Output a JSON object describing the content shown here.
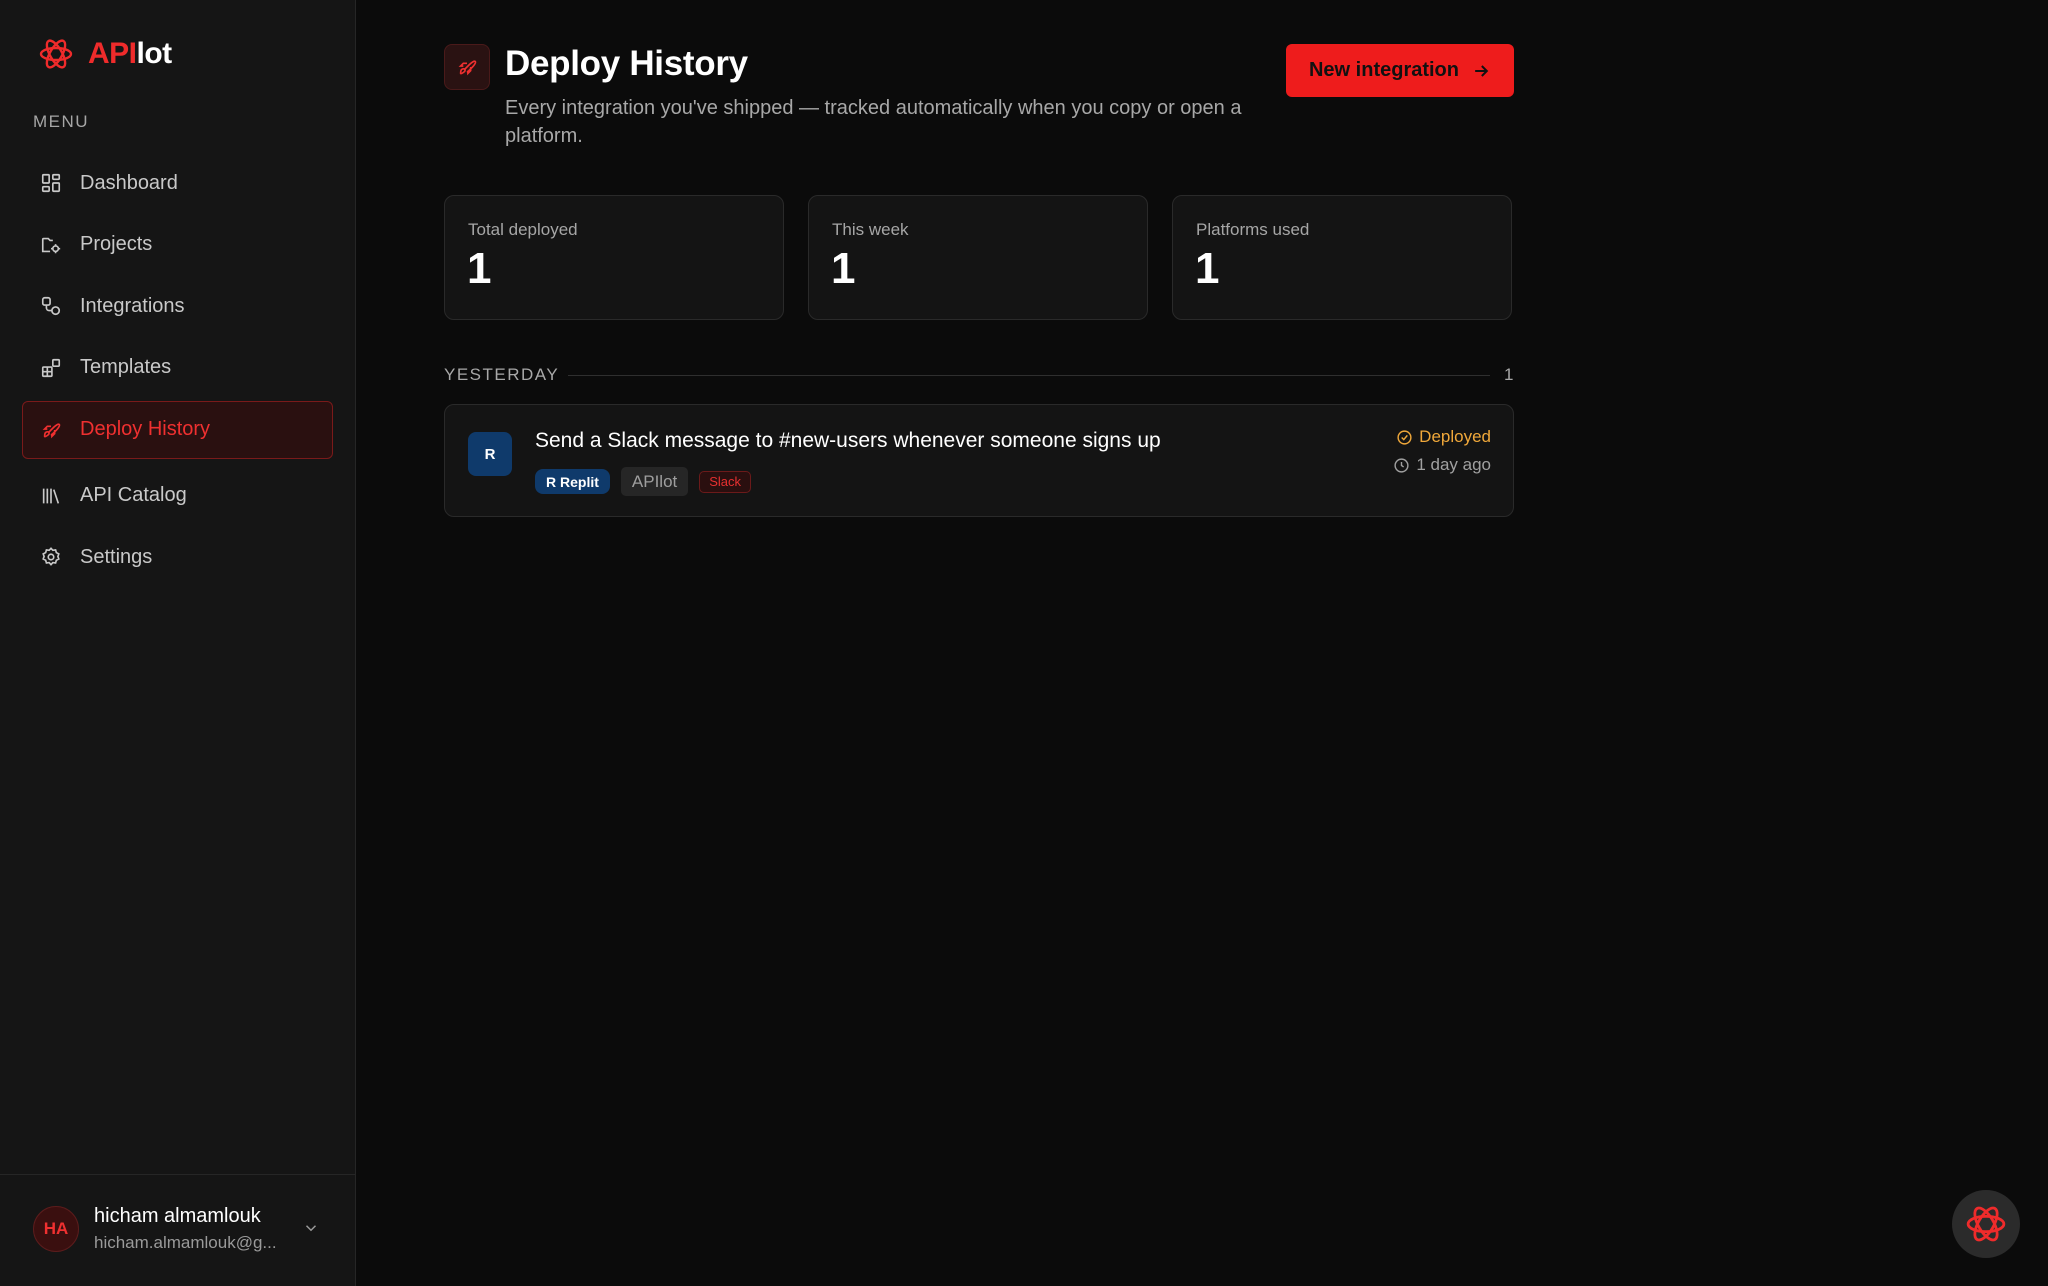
{
  "brand": {
    "name_accent": "API",
    "name_rest": "lot",
    "logo_icon": "apilot-logo-icon"
  },
  "sidebar": {
    "menu_label": "MENU",
    "items": [
      {
        "label": "Dashboard",
        "icon": "dashboard-icon"
      },
      {
        "label": "Projects",
        "icon": "projects-icon"
      },
      {
        "label": "Integrations",
        "icon": "integrations-icon"
      },
      {
        "label": "Templates",
        "icon": "templates-icon"
      },
      {
        "label": "Deploy History",
        "icon": "rocket-icon",
        "active": true
      },
      {
        "label": "API Catalog",
        "icon": "library-icon"
      },
      {
        "label": "Settings",
        "icon": "gear-icon"
      }
    ]
  },
  "user": {
    "initials": "HA",
    "name": "hicham almamlouk",
    "email": "hicham.almamlouk@g..."
  },
  "header": {
    "title": "Deploy History",
    "subtitle": "Every integration you've shipped — tracked automatically when you copy or open a platform.",
    "new_button_label": "New integration"
  },
  "stats": [
    {
      "label": "Total deployed",
      "value": "1"
    },
    {
      "label": "This week",
      "value": "1"
    },
    {
      "label": "Platforms used",
      "value": "1"
    }
  ],
  "groups": [
    {
      "label": "YESTERDAY",
      "count": "1",
      "items": [
        {
          "avatar": "R",
          "title": "Send a Slack message to #new-users whenever someone signs up",
          "tags": {
            "platform": "R Replit",
            "source": "APIlot",
            "service": "Slack"
          },
          "status": "Deployed",
          "time": "1 day ago"
        }
      ]
    }
  ],
  "colors": {
    "accent": "#ee1c1c",
    "status_deployed": "#f0a83a",
    "replit_badge": "#0f3a6b",
    "background": "#0b0b0b",
    "sidebar": "#151515"
  }
}
